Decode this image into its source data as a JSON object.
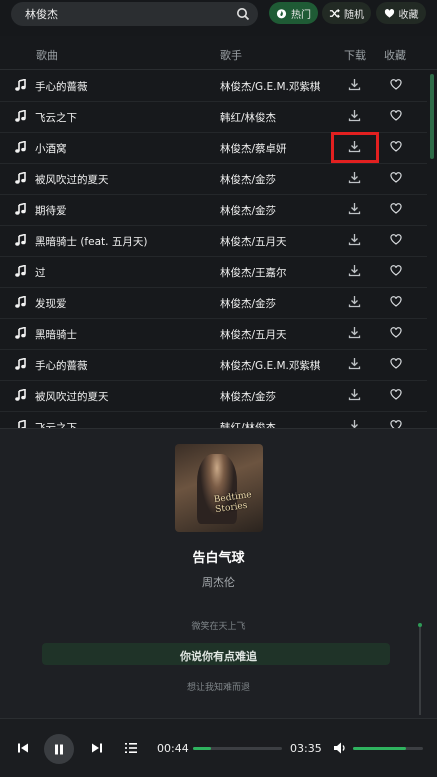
{
  "search": {
    "value": "林俊杰"
  },
  "tabs": [
    {
      "label": "热门",
      "icon": "flame-icon",
      "active": true
    },
    {
      "label": "随机",
      "icon": "shuffle-icon",
      "active": false
    },
    {
      "label": "收藏",
      "icon": "heart-icon",
      "active": false
    }
  ],
  "list": {
    "headers": {
      "song": "歌曲",
      "artist": "歌手",
      "download": "下载",
      "favorite": "收藏"
    },
    "rows": [
      {
        "title": "手心的蔷薇",
        "artist": "林俊杰/G.E.M.邓紫棋"
      },
      {
        "title": "飞云之下",
        "artist": "韩红/林俊杰"
      },
      {
        "title": "小酒窝",
        "artist": "林俊杰/蔡卓妍"
      },
      {
        "title": "被风吹过的夏天",
        "artist": "林俊杰/金莎"
      },
      {
        "title": "期待爱",
        "artist": "林俊杰/金莎"
      },
      {
        "title": "黑暗骑士 (feat. 五月天)",
        "artist": "林俊杰/五月天"
      },
      {
        "title": "过",
        "artist": "林俊杰/王嘉尔"
      },
      {
        "title": "发现爱",
        "artist": "林俊杰/金莎"
      },
      {
        "title": "黑暗骑士",
        "artist": "林俊杰/五月天"
      },
      {
        "title": "手心的蔷薇",
        "artist": "林俊杰/G.E.M.邓紫棋"
      },
      {
        "title": "被风吹过的夏天",
        "artist": "林俊杰/金莎"
      },
      {
        "title": "飞云之下",
        "artist": "韩红/林俊杰"
      }
    ]
  },
  "player": {
    "title": "告白气球",
    "artist": "周杰伦",
    "lyrics": {
      "prev": "微笑在天上飞",
      "current": "你说你有点难追",
      "next": "想让我知难而退"
    }
  },
  "controls": {
    "elapsed": "00:44",
    "duration": "03:35",
    "progress": 0.2,
    "volume": 0.75
  },
  "colors": {
    "accent": "#2fb35f",
    "active_pill": "#1f5b35",
    "highlight": "#e22020"
  }
}
